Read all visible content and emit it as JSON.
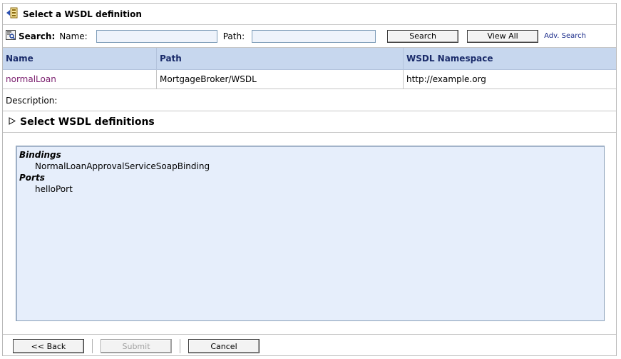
{
  "title": "Select a WSDL definition",
  "search": {
    "label": "Search:",
    "name_label": "Name:",
    "name_value": "",
    "path_label": "Path:",
    "path_value": "",
    "search_button": "Search",
    "view_all_button": "View All",
    "adv_search_link": "Adv. Search"
  },
  "table": {
    "columns": [
      "Name",
      "Path",
      "WSDL Namespace"
    ],
    "rows": [
      {
        "name": "normalLoan",
        "path": "MortgageBroker/WSDL",
        "namespace": "http://example.org"
      }
    ]
  },
  "description_label": "Description:",
  "section_title": "Select WSDL definitions",
  "definitions": {
    "bindings_heading": "Bindings",
    "bindings": [
      "NormalLoanApprovalServiceSoapBinding"
    ],
    "ports_heading": "Ports",
    "ports": [
      "helloPort"
    ]
  },
  "footer": {
    "back_button": "<< Back",
    "submit_button": "Submit",
    "cancel_button": "Cancel"
  },
  "icons": {
    "title_icon": "wsdl-definition-icon",
    "search_icon": "search-form-icon",
    "section_icon": "expand-triangle-icon"
  }
}
